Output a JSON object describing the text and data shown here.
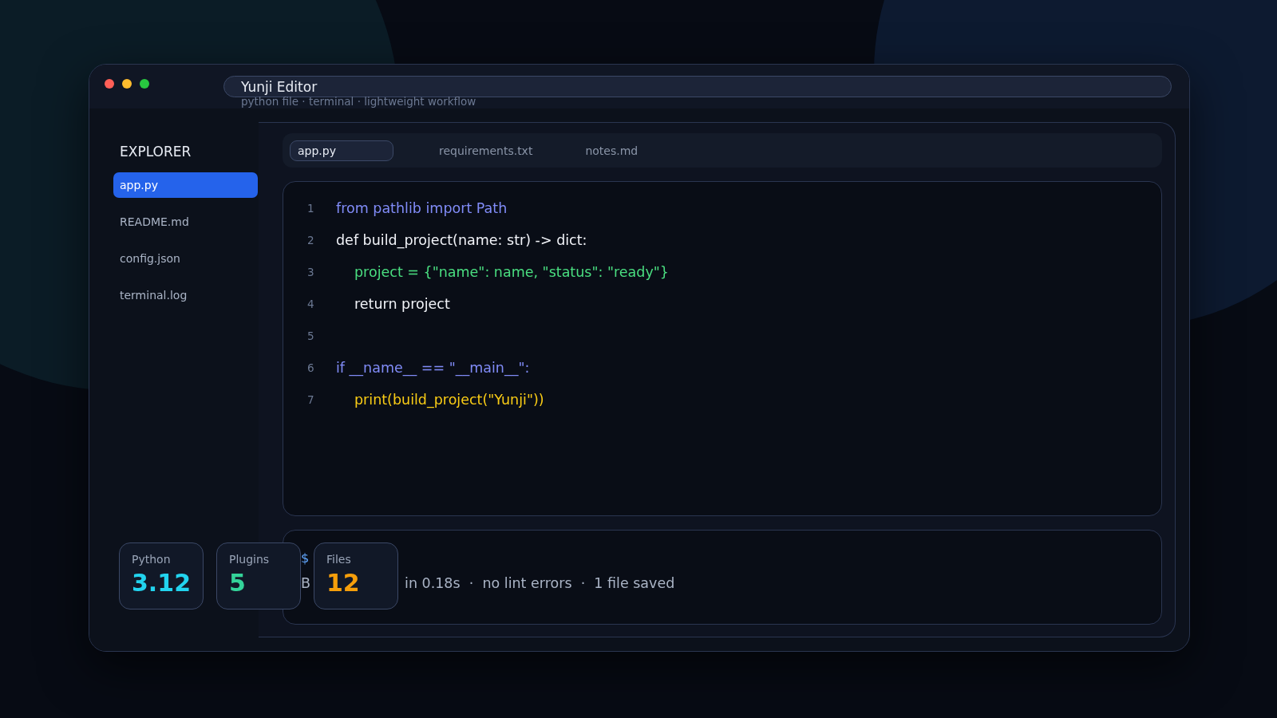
{
  "window": {
    "title": "Yunji Editor",
    "subtitle": "python file · terminal · lightweight workflow"
  },
  "sidebar": {
    "heading": "EXPLORER",
    "items": [
      {
        "label": "app.py",
        "selected": true
      },
      {
        "label": "README.md",
        "selected": false
      },
      {
        "label": "config.json",
        "selected": false
      },
      {
        "label": "terminal.log",
        "selected": false
      }
    ]
  },
  "tabs": [
    {
      "label": "app.py",
      "selected": true
    },
    {
      "label": "requirements.txt",
      "selected": false
    },
    {
      "label": "notes.md",
      "selected": false
    }
  ],
  "code": {
    "lines": [
      {
        "number": "1",
        "text": "from pathlib import Path",
        "kind": "keyword",
        "indented": false
      },
      {
        "number": "2",
        "text": "def build_project(name: str) -> dict:",
        "kind": "plain",
        "indented": false
      },
      {
        "number": "3",
        "text": "project = {\"name\": name, \"status\": \"ready\"}",
        "kind": "string",
        "indented": true
      },
      {
        "number": "4",
        "text": "return project",
        "kind": "plain",
        "indented": true
      },
      {
        "number": "5"
      },
      {
        "number": "6",
        "text": "if __name__ == \"__main__\":",
        "kind": "keyword",
        "indented": false
      },
      {
        "number": "7",
        "text": "print(build_project(\"Yunji\"))",
        "kind": "call",
        "indented": true
      }
    ]
  },
  "terminal": {
    "prompt": "$",
    "output_head": "B",
    "output_tail": "in 0.18s  ·  no lint errors  ·  1 file saved"
  },
  "stats": [
    {
      "label": "Python",
      "value": "3.12",
      "color": "#22d3ee"
    },
    {
      "label": "Plugins",
      "value": "5",
      "color": "#34d399"
    },
    {
      "label": "Files",
      "value": "12",
      "color": "#f59e0b"
    }
  ]
}
